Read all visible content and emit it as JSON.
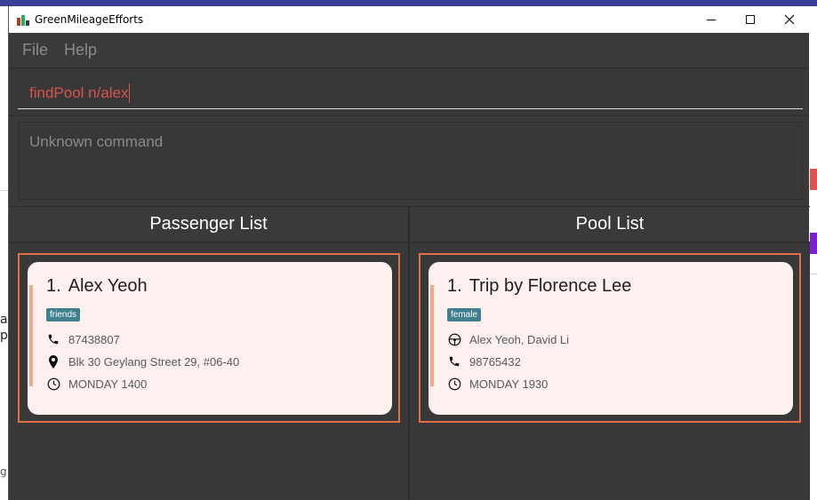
{
  "window": {
    "title": "GreenMileageEfforts"
  },
  "menu": {
    "file": "File",
    "help": "Help"
  },
  "command": {
    "value": "findPool n/alex"
  },
  "result": {
    "text": "Unknown command"
  },
  "passenger_list": {
    "title": "Passenger List",
    "items": [
      {
        "index": "1.",
        "name": "Alex Yeoh",
        "tag": "friends",
        "phone": "87438807",
        "address": "Blk 30 Geylang Street 29, #06-40",
        "time": "MONDAY 1400"
      }
    ]
  },
  "pool_list": {
    "title": "Pool List",
    "items": [
      {
        "index": "1.",
        "name": "Trip by Florence Lee",
        "tag": "female",
        "passengers": "Alex Yeoh, David Li",
        "phone": "98765432",
        "time": "MONDAY 1930"
      }
    ]
  },
  "background": {
    "glyph_1": "a",
    "glyph_2": "p",
    "glyph_3": "g"
  },
  "colors": {
    "accent_frame": "#e07048",
    "error_text": "#d9534f",
    "tag_bg": "#3f7f8f",
    "card_bg": "#fdf0ef",
    "window_bg": "#3a3a3a"
  }
}
